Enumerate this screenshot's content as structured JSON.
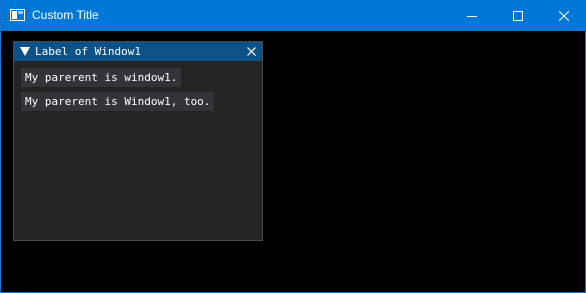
{
  "os_window": {
    "title": "Custom Title",
    "titlebar_color": "#0078d7",
    "icons": {
      "app": "app-window-icon",
      "minimize": "minimize-icon",
      "maximize": "maximize-icon",
      "close": "close-icon"
    }
  },
  "imgui_window": {
    "title": "Label of Window1",
    "titlebar_color": "#0c5289",
    "background_color": "#242424",
    "icons": {
      "collapse": "collapse-arrow-icon",
      "close": "close-icon"
    },
    "items": [
      {
        "label": "My parerent is window1."
      },
      {
        "label": "My parerent is Window1, too."
      }
    ]
  }
}
